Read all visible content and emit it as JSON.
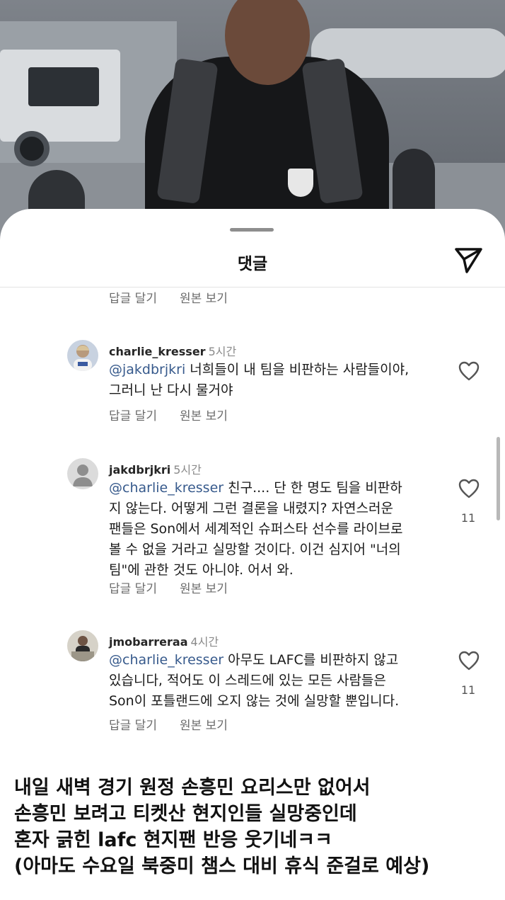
{
  "sheet": {
    "title": "댓글",
    "share_icon": "paper-plane-icon"
  },
  "actions": {
    "reply": "답글 달기",
    "view_original": "원본 보기"
  },
  "comments": [
    {
      "username": "charlie_kresser",
      "time": "5시간",
      "mention": "@jakdbrjkri",
      "lines": [
        "너희들이 내 팀을 비판하는 사람들이야,",
        "그러니 난 다시 물거야"
      ],
      "likes": ""
    },
    {
      "username": "jakdbrjkri",
      "time": "5시간",
      "mention": "@charlie_kresser",
      "lines": [
        "친구.... 단 한 명도 팀을 비판하",
        "지 않는다. 어떻게 그런 결론을 내렸지? 자연스러운",
        "팬들은 Son에서 세계적인 슈퍼스타 선수를 라이브로",
        "볼 수 없을 거라고 실망할 것이다. 이건 심지어 \"너의",
        "팀\"에 관한 것도 아니야. 어서 와."
      ],
      "likes": "11"
    },
    {
      "username": "jmobarreraa",
      "time": "4시간",
      "mention": "@charlie_kresser",
      "lines": [
        "아무도 LAFC를 비판하지 않고",
        "있습니다, 적어도 이 스레드에 있는 모든 사람들은",
        "Son이 포틀랜드에 오지 않는 것에 실망할 뿐입니다."
      ],
      "likes": "11"
    }
  ],
  "caption": [
    "내일 새벽 경기 원정 손흥민 요리스만 없어서",
    "손흥민 보려고 티켓산 현지인들 실망중인데",
    "혼자 긁힌 lafc 현지팬 반응 웃기네ㅋㅋ",
    "(아마도 수요일 북중미 챔스 대비 휴식 준걸로 예상)"
  ],
  "colors": {
    "mention": "#375a8c",
    "secondary_text": "#6b6b6b",
    "time_text": "#8a8a8a"
  }
}
